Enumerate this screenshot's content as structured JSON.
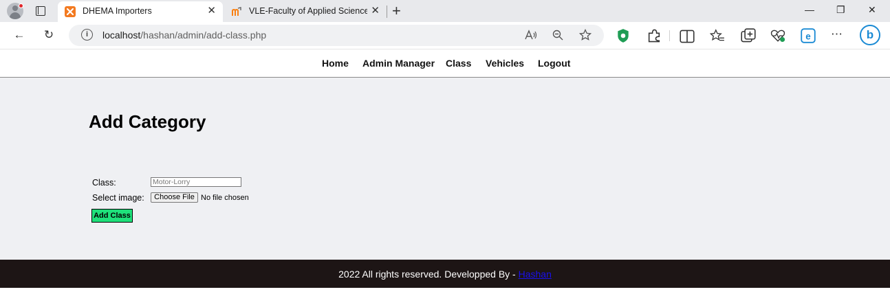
{
  "browser": {
    "tabs": [
      {
        "title": "DHEMA Importers",
        "active": true,
        "favicon": "xampp-icon",
        "favicon_color": "#f37a20"
      },
      {
        "title": "VLE-Faculty of Applied Science: L",
        "active": false,
        "favicon": "moodle-icon",
        "favicon_color": "#f98012"
      }
    ],
    "close_glyph": "✕",
    "new_tab_glyph": "+",
    "window": {
      "minimize": "—",
      "restore": "❐",
      "close": "✕"
    },
    "nav": {
      "back": "←",
      "reload": "↻"
    },
    "address": {
      "host": "localhost",
      "path": "/hashan/admin/add-class.php"
    },
    "bing_label": "b",
    "accent_color": "#1a8ad4"
  },
  "site": {
    "nav_items": [
      "Home",
      "Admin Manager",
      "Class",
      "Vehicles",
      "Logout"
    ],
    "heading": "Add Category",
    "form": {
      "class_label": "Class:",
      "class_placeholder": "Motor-Lorry",
      "image_label": "Select image:",
      "file_button": "Choose File",
      "file_status": "No file chosen",
      "submit_label": "Add Class",
      "submit_color": "#1ee07a"
    },
    "footer": {
      "text": "2022 All rights reserved. Developped By - ",
      "link": "Hashan",
      "bg_color": "#1d1515"
    }
  }
}
